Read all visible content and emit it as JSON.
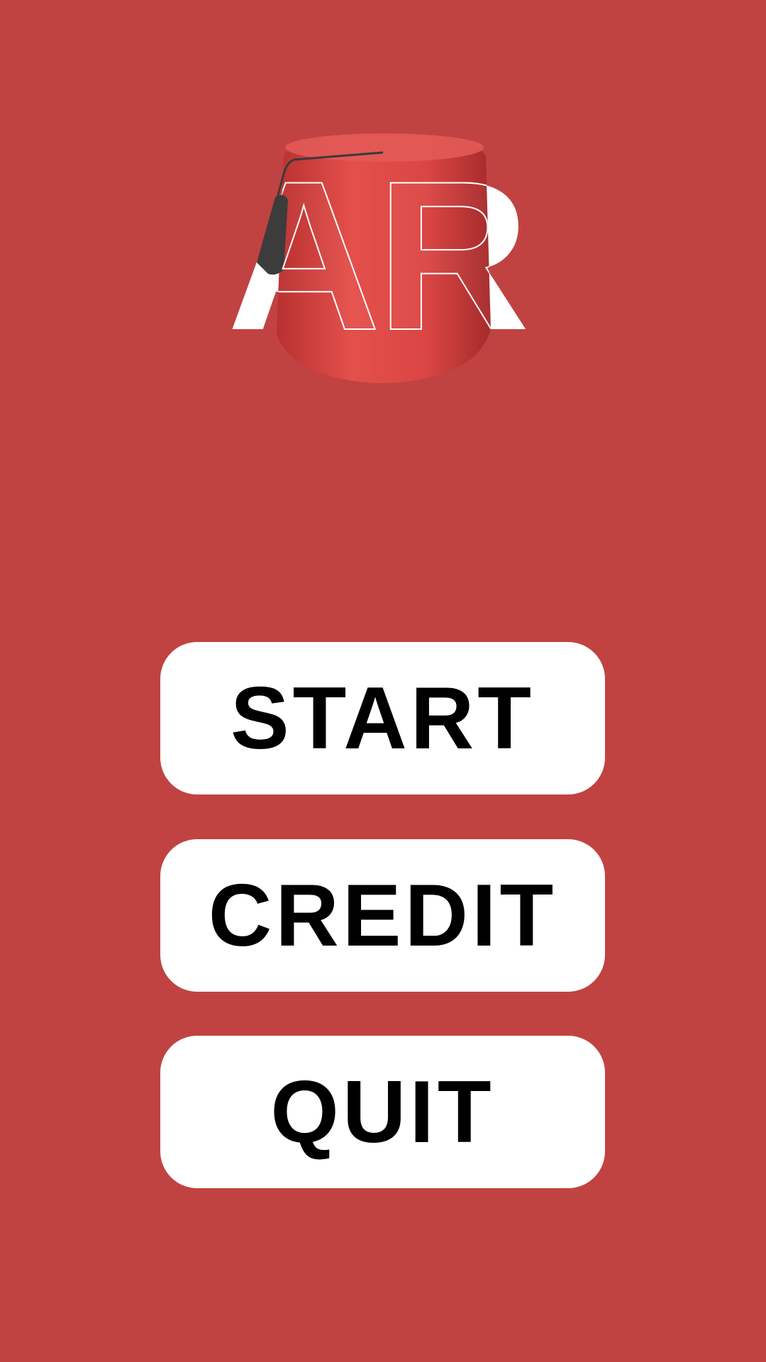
{
  "logo": {
    "text": "AR",
    "icon": "fez-hat-icon"
  },
  "menu": {
    "start_label": "START",
    "credit_label": "CREDIT",
    "quit_label": "QUIT"
  },
  "colors": {
    "background": "#c14341",
    "button_bg": "#ffffff",
    "button_text": "#000000",
    "fez_red": "#d9433f"
  }
}
